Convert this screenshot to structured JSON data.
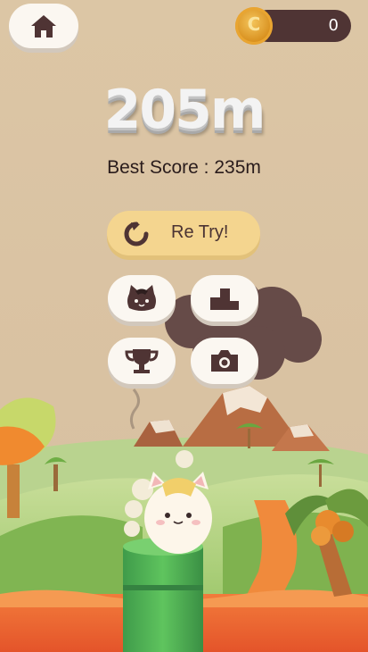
{
  "hud": {
    "coins": "0",
    "icons": {
      "home": "house-icon",
      "coin": "coin-icon"
    }
  },
  "result": {
    "distance": "205m",
    "best_score": "Best Score : 235m"
  },
  "buttons": {
    "retry_label": "Re Try!",
    "retry_icon": "retry-arrow-icon",
    "characters_icon": "cat-face-icon",
    "ranking_icon": "podium-icon",
    "trophy_icon": "trophy-icon",
    "screenshot_icon": "camera-icon"
  },
  "colors": {
    "sky": "#dac4a3",
    "button_bg": "#fbf7f1",
    "retry_bg": "#f4d58f",
    "icon_dark": "#4f3434",
    "coin_bar": "#4f3434"
  }
}
